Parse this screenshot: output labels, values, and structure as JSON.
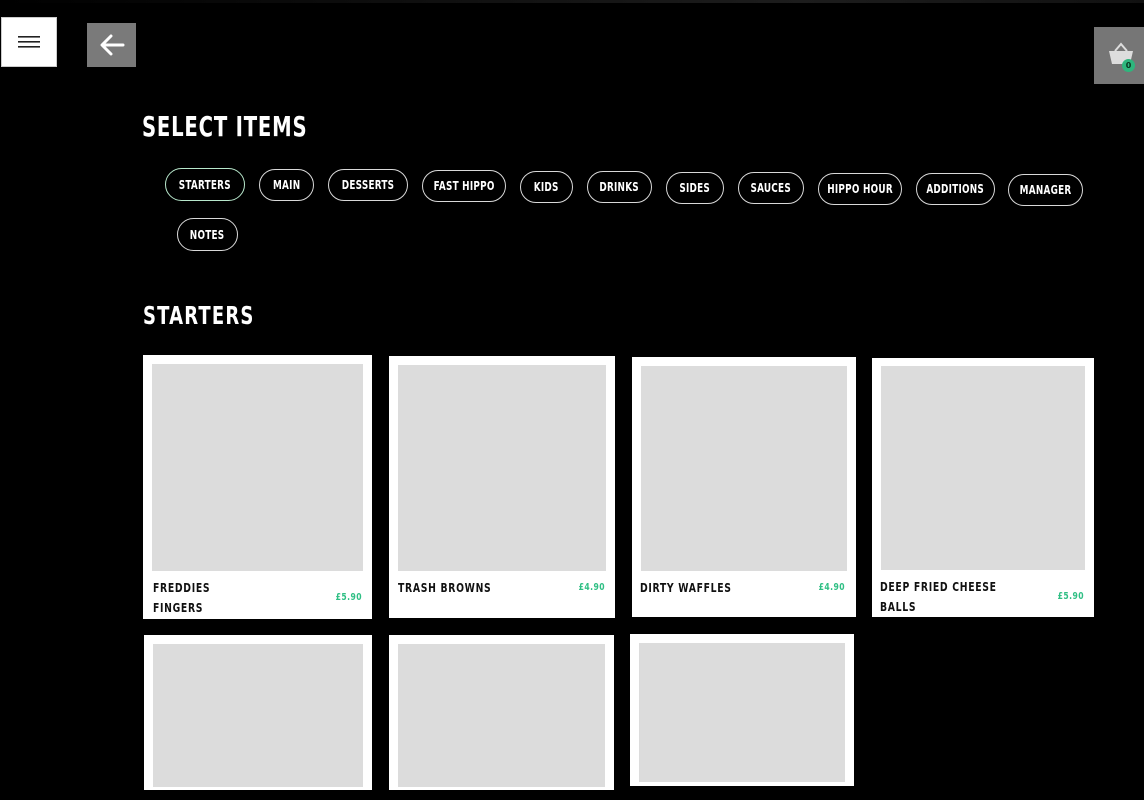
{
  "header": {
    "menu_icon": "hamburger-icon",
    "back_icon": "arrow-left-icon",
    "basket_icon": "basket-icon",
    "basket_count": "0"
  },
  "page_title": "SELECT ITEMS",
  "categories": [
    {
      "label": "STARTERS",
      "active": true
    },
    {
      "label": "MAIN"
    },
    {
      "label": "DESSERTS"
    },
    {
      "label": "FAST HIPPO"
    },
    {
      "label": "KIDS"
    },
    {
      "label": "DRINKS"
    },
    {
      "label": "SIDES"
    },
    {
      "label": "SAUCES"
    },
    {
      "label": "HIPPO HOUR"
    },
    {
      "label": "ADDITIONS"
    },
    {
      "label": "MANAGER"
    },
    {
      "label": "NOTES"
    }
  ],
  "section": {
    "title": "STARTERS",
    "items": [
      {
        "name_line1": "FREDDIES",
        "name_line2": "FINGERS",
        "price": "£5.90"
      },
      {
        "name_line1": "TRASH BROWNS",
        "name_line2": "",
        "price": "£4.90"
      },
      {
        "name_line1": "DIRTY WAFFLES",
        "name_line2": "",
        "price": "£4.90"
      },
      {
        "name_line1": "DEEP FRIED CHEESE",
        "name_line2": "BALLS",
        "price": "£5.90"
      },
      {
        "name_line1": "",
        "name_line2": "",
        "price": ""
      },
      {
        "name_line1": "",
        "name_line2": "",
        "price": ""
      },
      {
        "name_line1": "",
        "name_line2": "",
        "price": ""
      }
    ]
  },
  "colors": {
    "background": "#000000",
    "accent": "#2fbf84",
    "card": "#ffffff",
    "placeholder": "#dcdcdc"
  }
}
